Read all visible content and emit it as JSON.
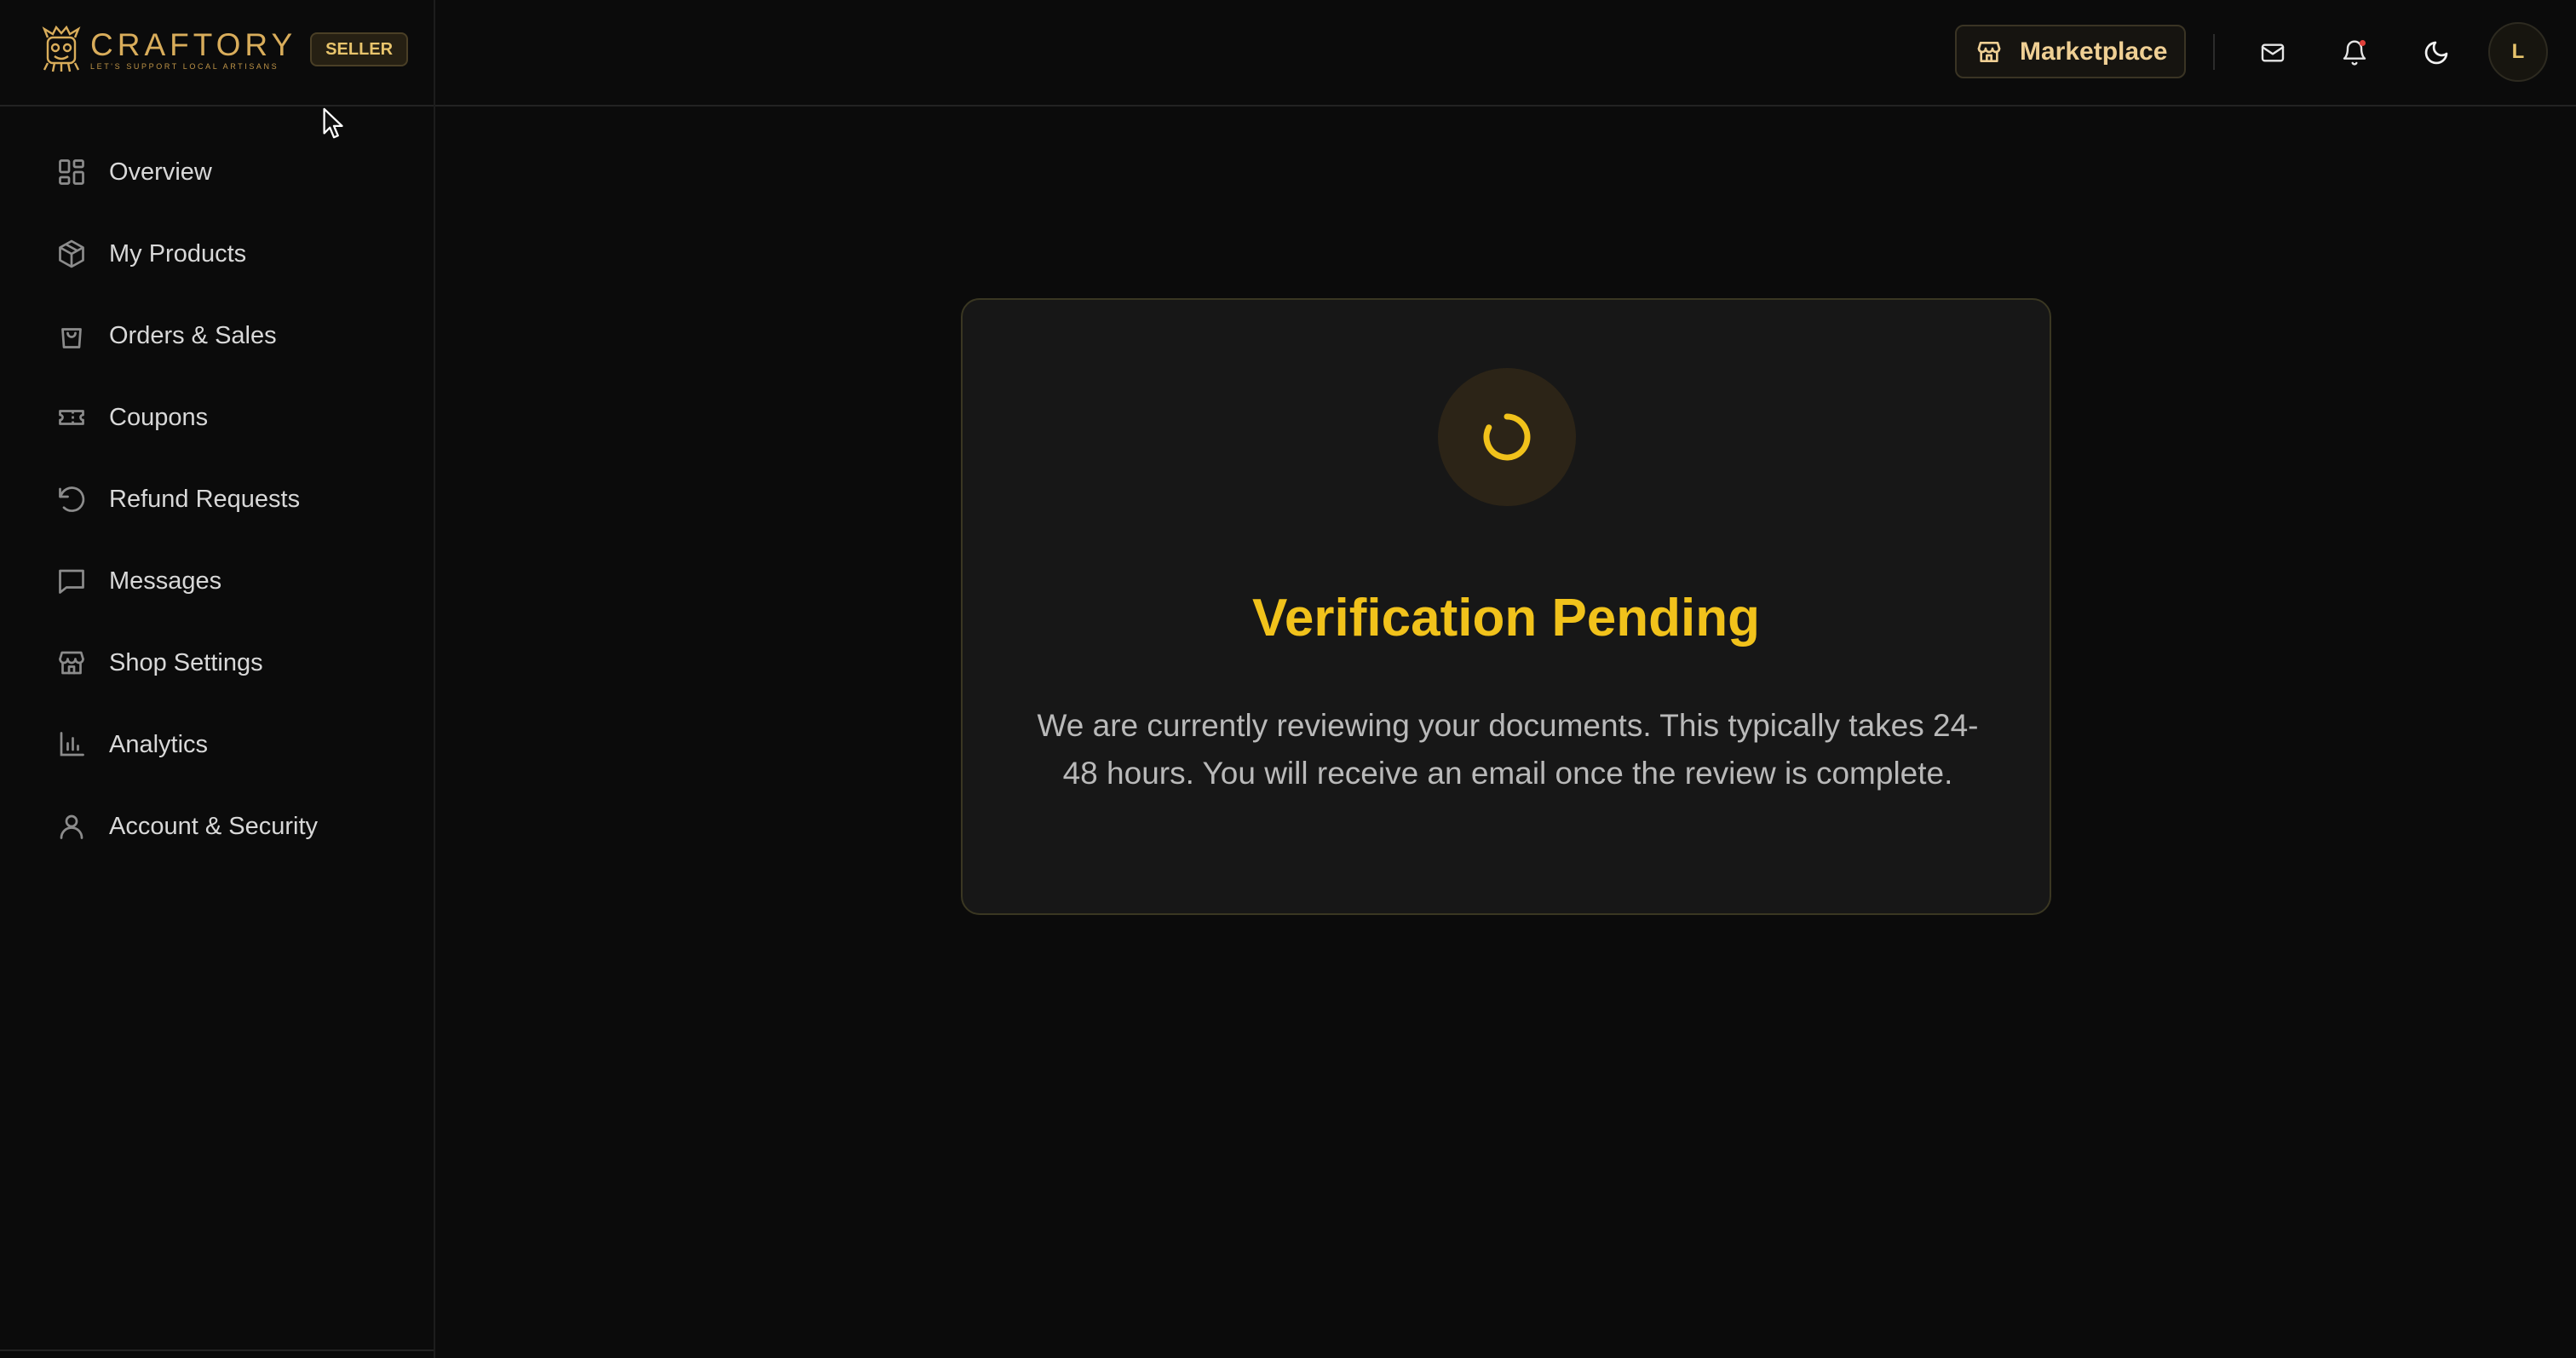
{
  "brand": {
    "name": "CRAFTORY",
    "tagline": "LET'S SUPPORT LOCAL ARTISANS",
    "badge": "SELLER"
  },
  "header": {
    "marketplace_label": "Marketplace",
    "avatar_initial": "L"
  },
  "sidebar": {
    "items": [
      {
        "label": "Overview",
        "icon": "grid-icon"
      },
      {
        "label": "My Products",
        "icon": "package-icon"
      },
      {
        "label": "Orders & Sales",
        "icon": "shopping-bag-icon"
      },
      {
        "label": "Coupons",
        "icon": "ticket-icon"
      },
      {
        "label": "Refund Requests",
        "icon": "rotate-ccw-icon"
      },
      {
        "label": "Messages",
        "icon": "message-square-icon"
      },
      {
        "label": "Shop Settings",
        "icon": "store-icon"
      },
      {
        "label": "Analytics",
        "icon": "bar-chart-icon"
      },
      {
        "label": "Account & Security",
        "icon": "user-icon"
      }
    ]
  },
  "main": {
    "title": "Verification Pending",
    "message": "We are currently reviewing your documents. This typically takes 24-48 hours. You will receive an email once the review is complete."
  },
  "colors": {
    "accent": "#f1c21b",
    "brand_gold": "#d9ad5b",
    "background": "#0b0b0b",
    "card": "#171717",
    "notification_dot": "#e0403a"
  }
}
